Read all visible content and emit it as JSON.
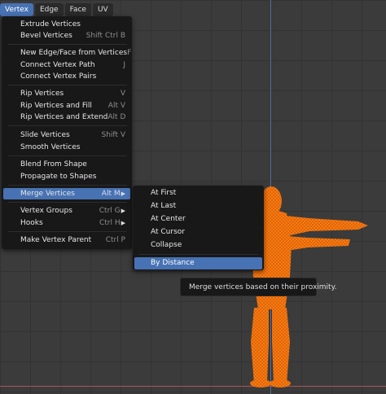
{
  "menubar": {
    "items": [
      {
        "label": "Vertex"
      },
      {
        "label": "Edge"
      },
      {
        "label": "Face"
      },
      {
        "label": "UV"
      }
    ]
  },
  "vertex_menu": {
    "items": [
      {
        "label": "Extrude Vertices",
        "shortcut": ""
      },
      {
        "label": "Bevel Vertices",
        "shortcut": "Shift Ctrl B"
      },
      {
        "label": "New Edge/Face from Vertices",
        "shortcut": "F"
      },
      {
        "label": "Connect Vertex Path",
        "shortcut": "J"
      },
      {
        "label": "Connect Vertex Pairs",
        "shortcut": ""
      },
      {
        "label": "Rip Vertices",
        "shortcut": "V"
      },
      {
        "label": "Rip Vertices and Fill",
        "shortcut": "Alt V"
      },
      {
        "label": "Rip Vertices and Extend",
        "shortcut": "Alt D"
      },
      {
        "label": "Slide Vertices",
        "shortcut": "Shift V"
      },
      {
        "label": "Smooth Vertices",
        "shortcut": ""
      },
      {
        "label": "Blend From Shape",
        "shortcut": ""
      },
      {
        "label": "Propagate to Shapes",
        "shortcut": ""
      },
      {
        "label": "Merge Vertices",
        "shortcut": "Alt M"
      },
      {
        "label": "Vertex Groups",
        "shortcut": "Ctrl G"
      },
      {
        "label": "Hooks",
        "shortcut": "Ctrl H"
      },
      {
        "label": "Make Vertex Parent",
        "shortcut": "Ctrl P"
      }
    ]
  },
  "merge_submenu": {
    "items": [
      {
        "label": "At First"
      },
      {
        "label": "At Last"
      },
      {
        "label": "At Center"
      },
      {
        "label": "At Cursor"
      },
      {
        "label": "Collapse"
      },
      {
        "label": "By Distance"
      }
    ]
  },
  "tooltip": {
    "text": "Merge vertices based on their proximity."
  },
  "colors": {
    "accent": "#4772b3",
    "mesh": "#ff7a12",
    "menu_bg": "#181818",
    "viewport_bg": "#3b3b3b"
  },
  "icons": {
    "submenu_arrow": "triangle-right-icon"
  }
}
